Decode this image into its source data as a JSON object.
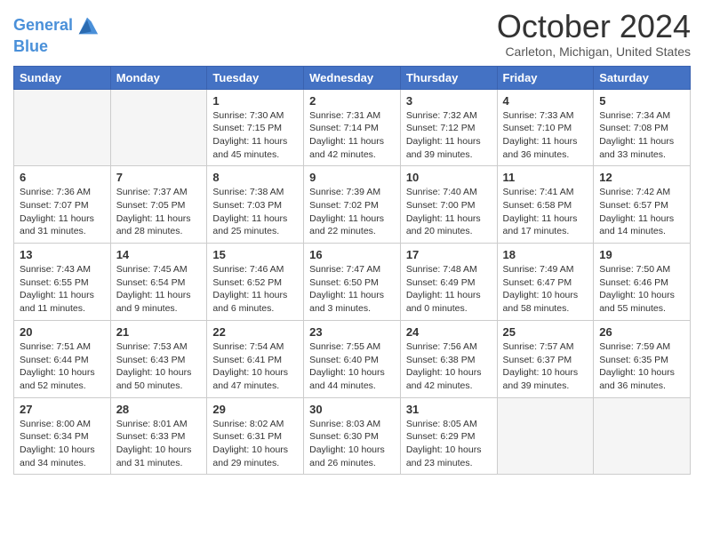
{
  "header": {
    "logo_line1": "General",
    "logo_line2": "Blue",
    "title": "October 2024",
    "subtitle": "Carleton, Michigan, United States"
  },
  "days_of_week": [
    "Sunday",
    "Monday",
    "Tuesday",
    "Wednesday",
    "Thursday",
    "Friday",
    "Saturday"
  ],
  "weeks": [
    [
      {
        "day": "",
        "info": ""
      },
      {
        "day": "",
        "info": ""
      },
      {
        "day": "1",
        "sunrise": "Sunrise: 7:30 AM",
        "sunset": "Sunset: 7:15 PM",
        "daylight": "Daylight: 11 hours and 45 minutes."
      },
      {
        "day": "2",
        "sunrise": "Sunrise: 7:31 AM",
        "sunset": "Sunset: 7:14 PM",
        "daylight": "Daylight: 11 hours and 42 minutes."
      },
      {
        "day": "3",
        "sunrise": "Sunrise: 7:32 AM",
        "sunset": "Sunset: 7:12 PM",
        "daylight": "Daylight: 11 hours and 39 minutes."
      },
      {
        "day": "4",
        "sunrise": "Sunrise: 7:33 AM",
        "sunset": "Sunset: 7:10 PM",
        "daylight": "Daylight: 11 hours and 36 minutes."
      },
      {
        "day": "5",
        "sunrise": "Sunrise: 7:34 AM",
        "sunset": "Sunset: 7:08 PM",
        "daylight": "Daylight: 11 hours and 33 minutes."
      }
    ],
    [
      {
        "day": "6",
        "sunrise": "Sunrise: 7:36 AM",
        "sunset": "Sunset: 7:07 PM",
        "daylight": "Daylight: 11 hours and 31 minutes."
      },
      {
        "day": "7",
        "sunrise": "Sunrise: 7:37 AM",
        "sunset": "Sunset: 7:05 PM",
        "daylight": "Daylight: 11 hours and 28 minutes."
      },
      {
        "day": "8",
        "sunrise": "Sunrise: 7:38 AM",
        "sunset": "Sunset: 7:03 PM",
        "daylight": "Daylight: 11 hours and 25 minutes."
      },
      {
        "day": "9",
        "sunrise": "Sunrise: 7:39 AM",
        "sunset": "Sunset: 7:02 PM",
        "daylight": "Daylight: 11 hours and 22 minutes."
      },
      {
        "day": "10",
        "sunrise": "Sunrise: 7:40 AM",
        "sunset": "Sunset: 7:00 PM",
        "daylight": "Daylight: 11 hours and 20 minutes."
      },
      {
        "day": "11",
        "sunrise": "Sunrise: 7:41 AM",
        "sunset": "Sunset: 6:58 PM",
        "daylight": "Daylight: 11 hours and 17 minutes."
      },
      {
        "day": "12",
        "sunrise": "Sunrise: 7:42 AM",
        "sunset": "Sunset: 6:57 PM",
        "daylight": "Daylight: 11 hours and 14 minutes."
      }
    ],
    [
      {
        "day": "13",
        "sunrise": "Sunrise: 7:43 AM",
        "sunset": "Sunset: 6:55 PM",
        "daylight": "Daylight: 11 hours and 11 minutes."
      },
      {
        "day": "14",
        "sunrise": "Sunrise: 7:45 AM",
        "sunset": "Sunset: 6:54 PM",
        "daylight": "Daylight: 11 hours and 9 minutes."
      },
      {
        "day": "15",
        "sunrise": "Sunrise: 7:46 AM",
        "sunset": "Sunset: 6:52 PM",
        "daylight": "Daylight: 11 hours and 6 minutes."
      },
      {
        "day": "16",
        "sunrise": "Sunrise: 7:47 AM",
        "sunset": "Sunset: 6:50 PM",
        "daylight": "Daylight: 11 hours and 3 minutes."
      },
      {
        "day": "17",
        "sunrise": "Sunrise: 7:48 AM",
        "sunset": "Sunset: 6:49 PM",
        "daylight": "Daylight: 11 hours and 0 minutes."
      },
      {
        "day": "18",
        "sunrise": "Sunrise: 7:49 AM",
        "sunset": "Sunset: 6:47 PM",
        "daylight": "Daylight: 10 hours and 58 minutes."
      },
      {
        "day": "19",
        "sunrise": "Sunrise: 7:50 AM",
        "sunset": "Sunset: 6:46 PM",
        "daylight": "Daylight: 10 hours and 55 minutes."
      }
    ],
    [
      {
        "day": "20",
        "sunrise": "Sunrise: 7:51 AM",
        "sunset": "Sunset: 6:44 PM",
        "daylight": "Daylight: 10 hours and 52 minutes."
      },
      {
        "day": "21",
        "sunrise": "Sunrise: 7:53 AM",
        "sunset": "Sunset: 6:43 PM",
        "daylight": "Daylight: 10 hours and 50 minutes."
      },
      {
        "day": "22",
        "sunrise": "Sunrise: 7:54 AM",
        "sunset": "Sunset: 6:41 PM",
        "daylight": "Daylight: 10 hours and 47 minutes."
      },
      {
        "day": "23",
        "sunrise": "Sunrise: 7:55 AM",
        "sunset": "Sunset: 6:40 PM",
        "daylight": "Daylight: 10 hours and 44 minutes."
      },
      {
        "day": "24",
        "sunrise": "Sunrise: 7:56 AM",
        "sunset": "Sunset: 6:38 PM",
        "daylight": "Daylight: 10 hours and 42 minutes."
      },
      {
        "day": "25",
        "sunrise": "Sunrise: 7:57 AM",
        "sunset": "Sunset: 6:37 PM",
        "daylight": "Daylight: 10 hours and 39 minutes."
      },
      {
        "day": "26",
        "sunrise": "Sunrise: 7:59 AM",
        "sunset": "Sunset: 6:35 PM",
        "daylight": "Daylight: 10 hours and 36 minutes."
      }
    ],
    [
      {
        "day": "27",
        "sunrise": "Sunrise: 8:00 AM",
        "sunset": "Sunset: 6:34 PM",
        "daylight": "Daylight: 10 hours and 34 minutes."
      },
      {
        "day": "28",
        "sunrise": "Sunrise: 8:01 AM",
        "sunset": "Sunset: 6:33 PM",
        "daylight": "Daylight: 10 hours and 31 minutes."
      },
      {
        "day": "29",
        "sunrise": "Sunrise: 8:02 AM",
        "sunset": "Sunset: 6:31 PM",
        "daylight": "Daylight: 10 hours and 29 minutes."
      },
      {
        "day": "30",
        "sunrise": "Sunrise: 8:03 AM",
        "sunset": "Sunset: 6:30 PM",
        "daylight": "Daylight: 10 hours and 26 minutes."
      },
      {
        "day": "31",
        "sunrise": "Sunrise: 8:05 AM",
        "sunset": "Sunset: 6:29 PM",
        "daylight": "Daylight: 10 hours and 23 minutes."
      },
      {
        "day": "",
        "info": ""
      },
      {
        "day": "",
        "info": ""
      }
    ]
  ]
}
